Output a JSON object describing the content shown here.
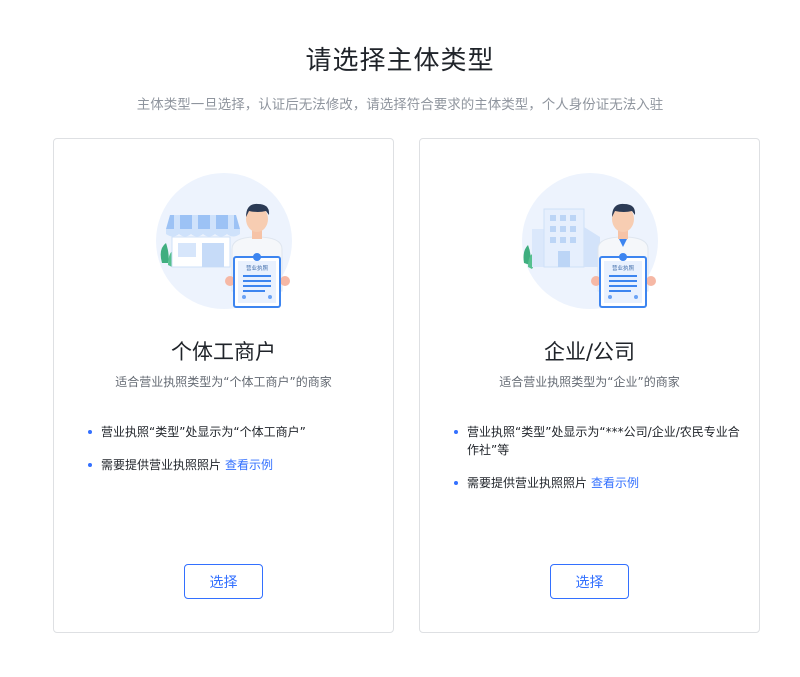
{
  "header": {
    "title": "请选择主体类型",
    "subtitle": "主体类型一旦选择，认证后无法修改，请选择符合要求的主体类型，个人身份证无法入驻"
  },
  "cards": [
    {
      "title": "个体工商户",
      "desc": "适合营业执照类型为“个体工商户”的商家",
      "req1": "营业执照“类型”处显示为“个体工商户”",
      "req2": "需要提供营业执照照片",
      "link": "查看示例",
      "button": "选择",
      "illus_text": "营业执照",
      "illus_icon": "storefront-icon"
    },
    {
      "title": "企业/公司",
      "desc": "适合营业执照类型为“企业”的商家",
      "req1": "营业执照“类型”处显示为“***公司/企业/农民专业合作社”等",
      "req2": "需要提供营业执照照片",
      "link": "查看示例",
      "button": "选择",
      "illus_text": "营业执照",
      "illus_icon": "office-building-icon"
    }
  ],
  "colors": {
    "accent": "#3370ff",
    "border": "#dee0e3",
    "muted": "#8f959e"
  }
}
